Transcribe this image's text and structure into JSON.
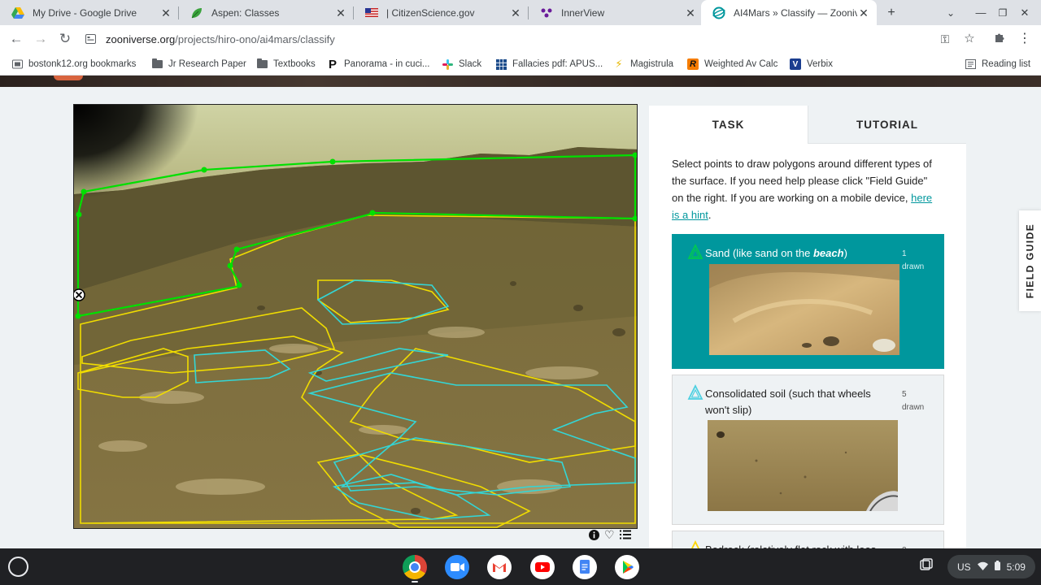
{
  "browser": {
    "tabs": [
      {
        "title": "My Drive - Google Drive",
        "icon": "google-drive-icon"
      },
      {
        "title": "Aspen: Classes",
        "icon": "aspen-leaf-icon"
      },
      {
        "title": "| CitizenScience.gov",
        "icon": "us-flag-icon"
      },
      {
        "title": "InnerView",
        "icon": "innerview-icon"
      },
      {
        "title": "AI4Mars » Classify — Zooniver",
        "icon": "zooniverse-icon",
        "active": true
      }
    ],
    "url_domain": "zooniverse.org",
    "url_path": "/projects/hiro-ono/ai4mars/classify"
  },
  "bookmarks": [
    {
      "label": "bostonk12.org bookmarks",
      "icon": "bookmark-folder-icon"
    },
    {
      "label": "Jr Research Paper",
      "icon": "folder-icon"
    },
    {
      "label": "Textbooks",
      "icon": "folder-icon"
    },
    {
      "label": "Panorama - in cuci...",
      "icon": "panorama-icon"
    },
    {
      "label": "Slack",
      "icon": "slack-icon"
    },
    {
      "label": "Fallacies pdf: APUS...",
      "icon": "grid-icon"
    },
    {
      "label": "Magistrula",
      "icon": "lightning-icon"
    },
    {
      "label": "Weighted Av Calc",
      "icon": "r-icon"
    },
    {
      "label": "Verbix",
      "icon": "verbix-icon"
    }
  ],
  "reading_list": "Reading list",
  "task_panel": {
    "tabs": [
      "TASK",
      "TUTORIAL"
    ],
    "instruction_text": "Select points to draw polygons around different types of the surface. If you need help please click \"Field Guide\" on the right. If you are working on a mobile device, ",
    "hint_link": "here is a hint",
    "instruction_end": ".",
    "choices": [
      {
        "label_pre": "Sand (like sand on the ",
        "label_em": "beach",
        "label_post": ")",
        "count": "1",
        "count_label": "drawn",
        "color": "#00c853",
        "selected": true
      },
      {
        "label": "Consolidated soil (such that wheels won't slip)",
        "count": "5",
        "count_label": "drawn",
        "color": "#4dd0e1",
        "selected": false
      },
      {
        "label": "Bedrock (relatively flat rock with loos",
        "count": "2",
        "color": "#ffd600",
        "selected": false
      }
    ]
  },
  "field_guide": "FIELD GUIDE",
  "system_tray": {
    "locale": "US",
    "time": "5:09"
  },
  "colors": {
    "teal": "#00979d",
    "sand_polygon": "#00e000",
    "soil_polygon": "#33d6d6",
    "bedrock_polygon": "#f0dc00"
  }
}
